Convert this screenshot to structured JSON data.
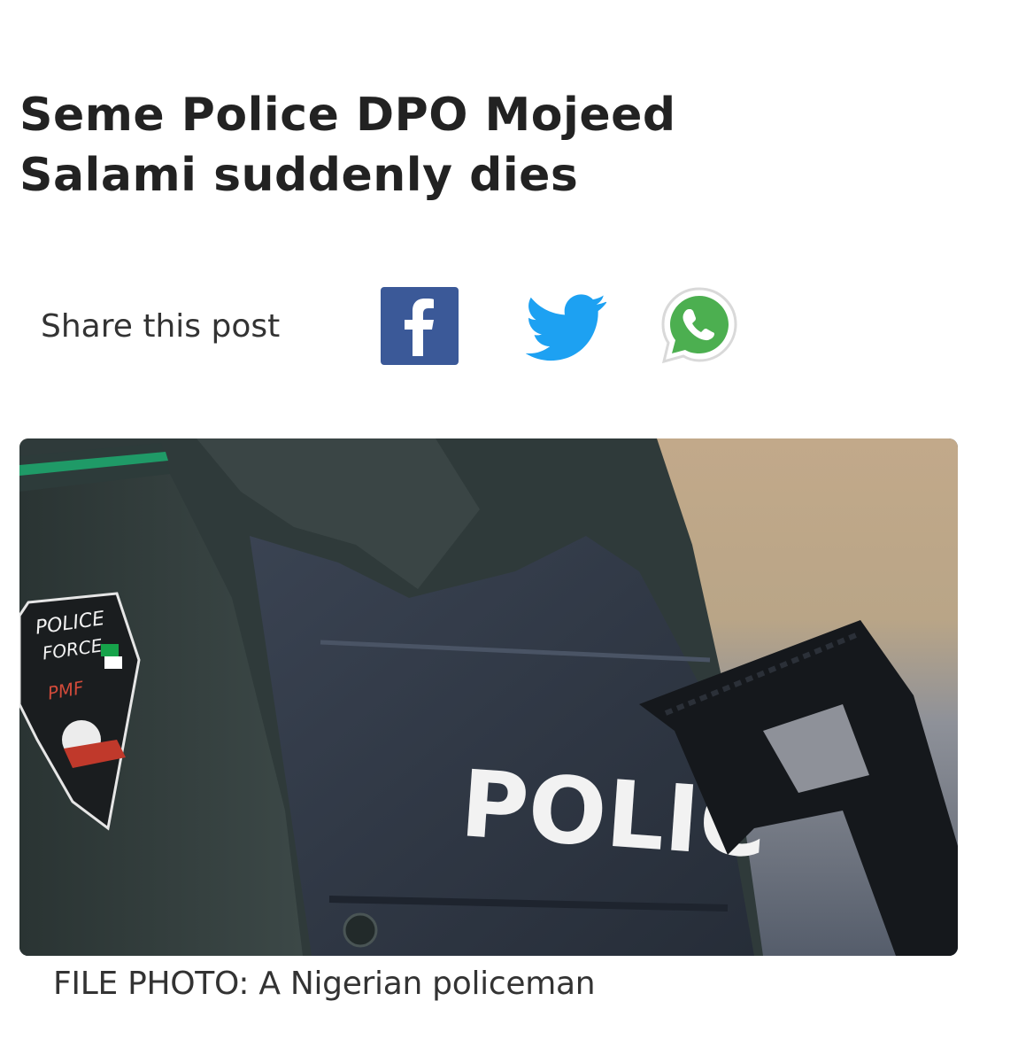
{
  "article": {
    "headline": "Seme Police DPO Mojeed Salami suddenly dies",
    "share": {
      "label": "Share this post",
      "buttons": [
        {
          "network": "facebook",
          "icon": "facebook-icon",
          "color": "#3b5998"
        },
        {
          "network": "twitter",
          "icon": "twitter-icon",
          "color": "#1da1f2"
        },
        {
          "network": "whatsapp",
          "icon": "whatsapp-icon",
          "color": "#4caf50"
        }
      ]
    },
    "image": {
      "subject": "policeman in bulletproof vest holding rifle",
      "vest_text": "POLIC",
      "patch_text_top": "POLICE",
      "patch_text_mid": "FORCE",
      "patch_text_low": "PMF"
    },
    "caption": "FILE PHOTO: A Nigerian policeman"
  }
}
